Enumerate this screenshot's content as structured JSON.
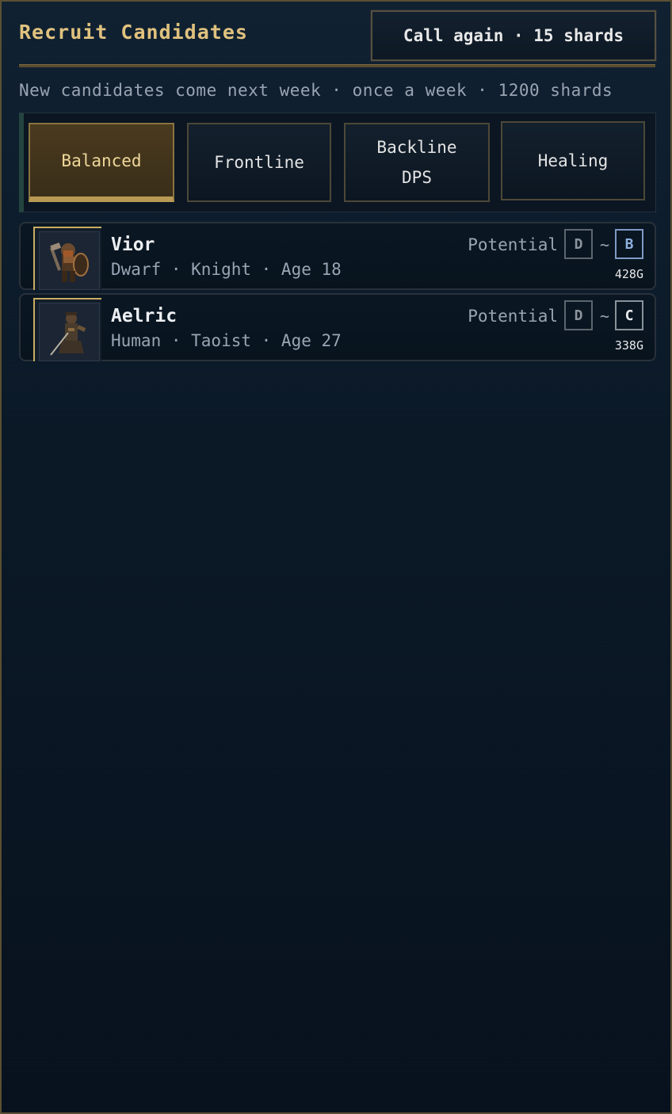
{
  "header": {
    "title": "Recruit Candidates",
    "call_again_label": "Call again · 15 shards"
  },
  "info_text": "New candidates come next week · once a week · 1200 shards",
  "tabs": [
    {
      "label_line1": "Balanced",
      "label_line2": "",
      "active": true
    },
    {
      "label_line1": "Frontline",
      "label_line2": "",
      "active": false
    },
    {
      "label_line1": "Backline",
      "label_line2": "DPS",
      "active": false
    },
    {
      "label_line1": "Healing",
      "label_line2": "",
      "active": false
    }
  ],
  "candidates": [
    {
      "name": "Vior",
      "details": "Dwarf · Knight · Age 18",
      "potential_label": "Potential",
      "potential_min": "D",
      "separator": "~",
      "potential_max": "B",
      "cost": "428G",
      "portrait_icon": "dwarf-knight-sprite"
    },
    {
      "name": "Aelric",
      "details": "Human · Taoist · Age 27",
      "potential_label": "Potential",
      "potential_min": "D",
      "separator": "~",
      "potential_max": "C",
      "cost": "338G",
      "portrait_icon": "human-taoist-sprite"
    }
  ],
  "colors": {
    "accent_gold": "#e0c27e",
    "active_tab_bg": "#4a3a1f",
    "grade_b": "#8fb0e0"
  }
}
